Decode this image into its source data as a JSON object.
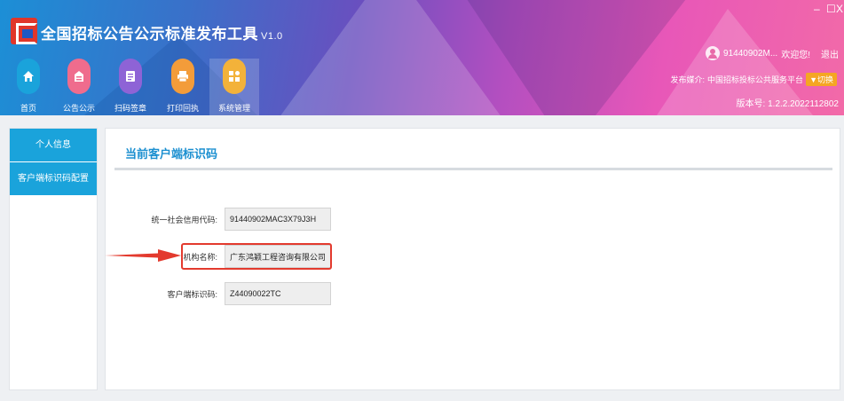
{
  "app": {
    "title": "全国招标公告公示标准发布工具",
    "version": "V1.0",
    "window_controls": {
      "minimize": "–",
      "maximize": "☐",
      "close": "X"
    }
  },
  "nav": {
    "items": [
      {
        "label": "首页",
        "icon": "home-icon",
        "color": "#1aa3db"
      },
      {
        "label": "公告公示",
        "icon": "announcement-icon",
        "color": "#ef6c8d"
      },
      {
        "label": "扫码签章",
        "icon": "scan-sign-icon",
        "color": "#8e63d6"
      },
      {
        "label": "打印回执",
        "icon": "printer-icon",
        "color": "#f39c3a"
      },
      {
        "label": "系统管理",
        "icon": "system-manage-icon",
        "color": "#f3b23a"
      }
    ],
    "active": "系统管理"
  },
  "user": {
    "name": "91440902M...",
    "welcome": "欢迎您!",
    "logout": "退出",
    "publisher_label": "发布媒介:",
    "publisher": "中国招标投标公共服务平台",
    "switch": "切换",
    "version_line": "版本号: 1.2.2.2022112802"
  },
  "sidebar": {
    "items": [
      {
        "label": "个人信息"
      },
      {
        "label": "客户端标识码配置"
      }
    ]
  },
  "main": {
    "title": "当前客户端标识码",
    "fields": [
      {
        "label": "统一社会信用代码:",
        "value": "91440902MAC3X79J3H"
      },
      {
        "label": "机构名称:",
        "value": "广东鸿颖工程咨询有限公司"
      },
      {
        "label": "客户端标识码:",
        "value": "Z44090022TC"
      }
    ]
  },
  "colors": {
    "accent": "#1aa3db",
    "highlight": "#e33a2e",
    "title": "#1b8fd0"
  }
}
